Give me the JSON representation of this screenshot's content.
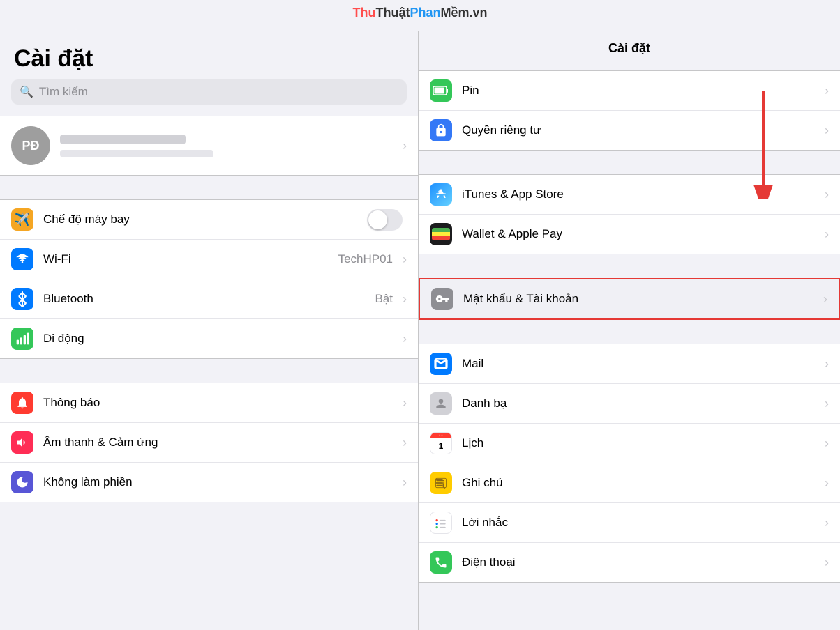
{
  "watermark": {
    "thu": "Thu",
    "thuat": "Thuật",
    "phan": "Phan",
    "mem": "Mềm",
    "vn": ".vn",
    "full": "ThuThuậtPhanMềm.vn"
  },
  "left": {
    "title": "Cài đặt",
    "search_placeholder": "Tìm kiếm",
    "profile": {
      "initials": "PĐ"
    },
    "sections": [
      {
        "items": [
          {
            "label": "Chế độ máy bay",
            "value": "",
            "has_toggle": true,
            "icon": "airplane",
            "icon_color": "orange"
          },
          {
            "label": "Wi-Fi",
            "value": "TechHP01",
            "has_toggle": false,
            "icon": "wifi",
            "icon_color": "blue"
          },
          {
            "label": "Bluetooth",
            "value": "Bật",
            "has_toggle": false,
            "icon": "bluetooth",
            "icon_color": "blue"
          },
          {
            "label": "Di động",
            "value": "",
            "has_toggle": false,
            "icon": "cellular",
            "icon_color": "green"
          }
        ]
      },
      {
        "items": [
          {
            "label": "Thông báo",
            "value": "",
            "has_toggle": false,
            "icon": "notifications",
            "icon_color": "red"
          },
          {
            "label": "Âm thanh & Cảm ứng",
            "value": "",
            "has_toggle": false,
            "icon": "sound",
            "icon_color": "pink"
          },
          {
            "label": "Không làm phiền",
            "value": "",
            "has_toggle": false,
            "icon": "dnd",
            "icon_color": "purple"
          }
        ]
      }
    ]
  },
  "right": {
    "title": "Cài đặt",
    "sections": [
      {
        "items": [
          {
            "label": "Pin",
            "icon": "battery",
            "icon_color": "green"
          },
          {
            "label": "Quyền riêng tư",
            "icon": "privacy",
            "icon_color": "blue"
          }
        ]
      },
      {
        "items": [
          {
            "label": "iTunes & App Store",
            "icon": "appstore",
            "icon_color": "appstore"
          },
          {
            "label": "Wallet & Apple Pay",
            "icon": "wallet",
            "icon_color": "wallet"
          }
        ]
      },
      {
        "items": [
          {
            "label": "Mật khẩu & Tài khoản",
            "icon": "password",
            "icon_color": "password",
            "highlighted": true
          }
        ]
      },
      {
        "items": [
          {
            "label": "Mail",
            "icon": "mail",
            "icon_color": "mail"
          },
          {
            "label": "Danh bạ",
            "icon": "contacts",
            "icon_color": "contacts"
          },
          {
            "label": "Lịch",
            "icon": "calendar",
            "icon_color": "calendar"
          },
          {
            "label": "Ghi chú",
            "icon": "notes",
            "icon_color": "notes"
          },
          {
            "label": "Lời nhắc",
            "icon": "reminders",
            "icon_color": "reminders"
          },
          {
            "label": "Điện thoại",
            "icon": "phone",
            "icon_color": "phone"
          }
        ]
      }
    ]
  }
}
